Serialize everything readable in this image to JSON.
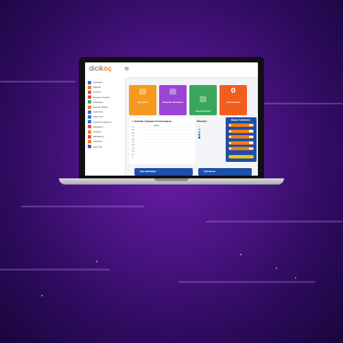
{
  "app": {
    "logo_main": "dicik",
    "logo_accent": "oç",
    "menu_glyph": "≡"
  },
  "sidebar": {
    "items": [
      {
        "label": "Anasayfa",
        "color": "#2f6fd6"
      },
      {
        "label": "Branşlar",
        "color": "#f07b1a"
      },
      {
        "label": "Görevler",
        "color": "#e04848"
      },
      {
        "label": "Deneme Sınavları",
        "color": "#e04848"
      },
      {
        "label": "Kütüphane",
        "color": "#3aa65a"
      },
      {
        "label": "Kaynak Kitaplar",
        "color": "#f07b1a"
      },
      {
        "label": "Canlı Ders",
        "color": "#2f6fd6"
      },
      {
        "label": "Sanal Sınıf",
        "color": "#2f6fd6"
      },
      {
        "label": "Çalışma Programım",
        "color": "#2f6fd6"
      },
      {
        "label": "Mesajlarım",
        "color": "#e04848"
      },
      {
        "label": "Testlerim",
        "color": "#f07b1a"
      },
      {
        "label": "Etkinliklerim",
        "color": "#e04848"
      },
      {
        "label": "Ödevlerim",
        "color": "#f07b1a"
      },
      {
        "label": "Çıkış Yap",
        "color": "#7a3bb8"
      }
    ]
  },
  "cards": [
    {
      "title": "Görevler",
      "color": "#f59a1e",
      "icon": "clipboard-icon"
    },
    {
      "title": "Deneme Sınavları",
      "color": "#9b45d6",
      "icon": "list-icon"
    },
    {
      "title": "Canlı Dersler",
      "color": "#3aa65a",
      "icon": "video-icon"
    },
    {
      "title": "Test Çözüm",
      "color": "#f25f1c",
      "value": "0"
    }
  ],
  "performance": {
    "title": "7 Günlük Çalışma Performansı",
    "y_ticks": [
      "1.0",
      "0.9",
      "0.8",
      "0.7",
      "0.6",
      "0.5",
      "0.4",
      "0.3",
      "0.2",
      "0.1",
      "0"
    ]
  },
  "colors_panel": {
    "title": "Renkler"
  },
  "ranking": {
    "title": "Başarı Sıralaman",
    "rows": [
      {
        "value": "1/1"
      },
      {
        "value": "1/1"
      },
      {
        "value": "1/1"
      },
      {
        "value": "1/1"
      },
      {
        "value": "1/1"
      }
    ]
  },
  "bottom": {
    "activities": "Son Aktiviteler",
    "homework": "Ödevlerim"
  }
}
